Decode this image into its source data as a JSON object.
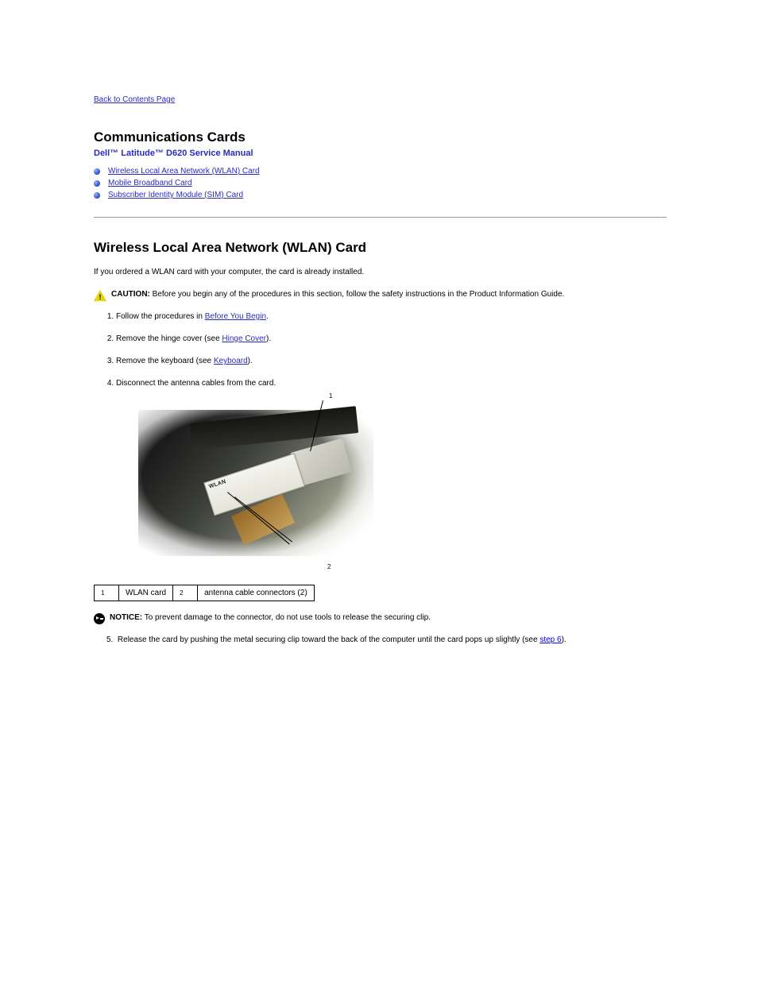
{
  "nav": {
    "back_link": "Back to Contents Page"
  },
  "doc_title": "Dell™ Latitude™ D620  Service Manual",
  "page_heading": "Communications Cards",
  "toc": [
    {
      "label": "Wireless Local Area Network (WLAN) Card"
    },
    {
      "label": "Mobile Broadband Card"
    },
    {
      "label": "Subscriber Identity Module (SIM) Card"
    }
  ],
  "section": {
    "title": "Wireless Local Area Network (WLAN) Card"
  },
  "intro": "If you ordered a WLAN card with your computer, the card is already installed.",
  "caution": {
    "lead": "CAUTION:",
    "text": "Before you begin any of the procedures in this section, follow the safety instructions in the Product Information Guide."
  },
  "steps": [
    {
      "text_before": "Follow the procedures in ",
      "link": "Before You Begin",
      "text_after": "."
    },
    {
      "text_before": "Remove the hinge cover (see ",
      "link": "Hinge Cover",
      "text_after": ")."
    },
    {
      "text_before": "Remove the keyboard (see ",
      "link": "Keyboard",
      "text_after": ")."
    },
    {
      "text_before": "Disconnect the antenna cables from the card.",
      "link": "",
      "text_after": ""
    }
  ],
  "card_label_text": "WLAN",
  "key_table": {
    "r1": {
      "n": "1",
      "label": "WLAN card"
    },
    "r2": {
      "n": "2",
      "label": "antenna cable connectors (2)"
    }
  },
  "notice": {
    "lead": "NOTICE:",
    "text": "To prevent damage to the connector, do not use tools to release the securing clip."
  },
  "step5": {
    "n": "5.",
    "text_before": "Release the card by pushing the metal securing clip toward the back of the computer until the card pops up slightly (see ",
    "link": "step 6",
    "text_after": ")."
  }
}
